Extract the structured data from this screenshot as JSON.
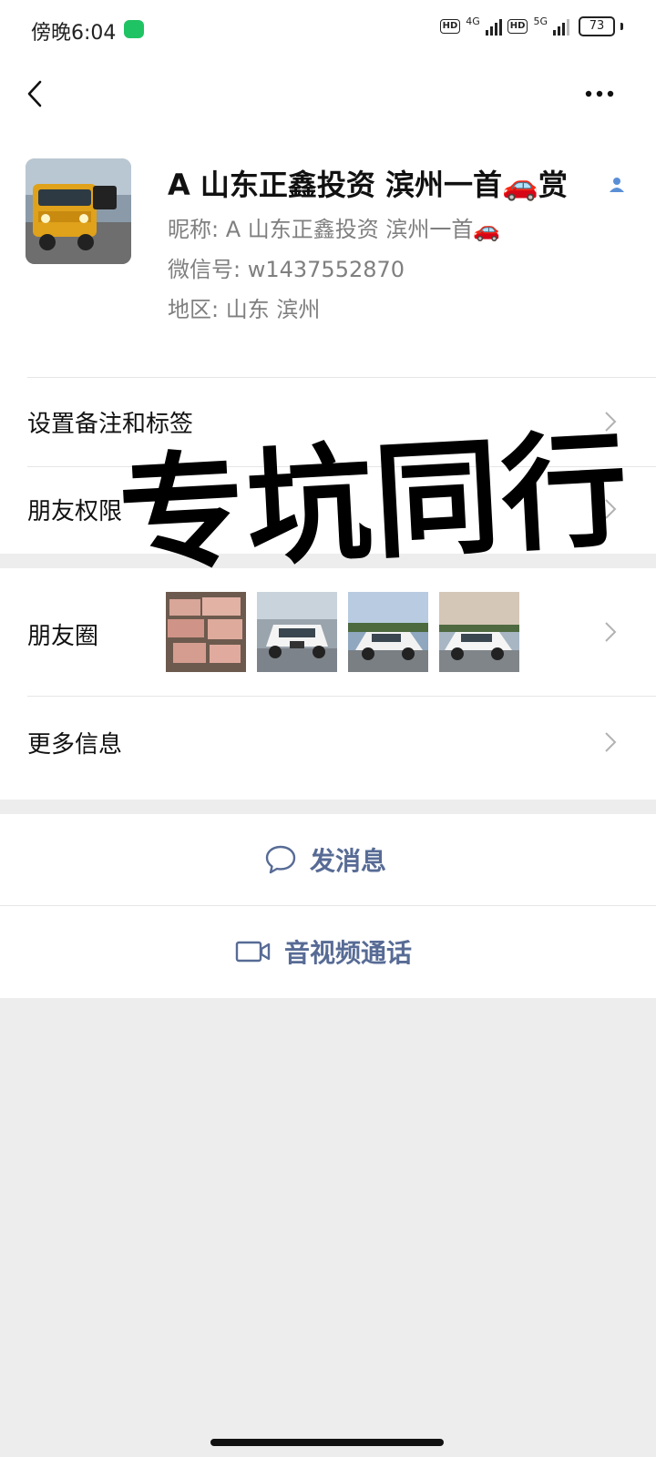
{
  "status": {
    "time": "傍晚6:04",
    "net1": "4G",
    "net2": "5G",
    "hd": "HD",
    "battery": "73"
  },
  "profile": {
    "title": "A 山东正鑫投资 滨州一首🚗赏",
    "nickname": "昵称: A 山东正鑫投资 滨州一首🚗",
    "wechat_id": "微信号: w1437552870",
    "region": "地区: 山东 滨州"
  },
  "rows": {
    "remark_label": "设置备注和标签",
    "permission_label": "朋友权限",
    "moments_label": "朋友圈",
    "more_label": "更多信息"
  },
  "actions": {
    "message_label": "发消息",
    "call_label": "音视频通话"
  },
  "overlay": {
    "text": "专坑同行"
  },
  "colors": {
    "link": "#576b95",
    "background": "#ededed",
    "status_app": "#20c363"
  }
}
